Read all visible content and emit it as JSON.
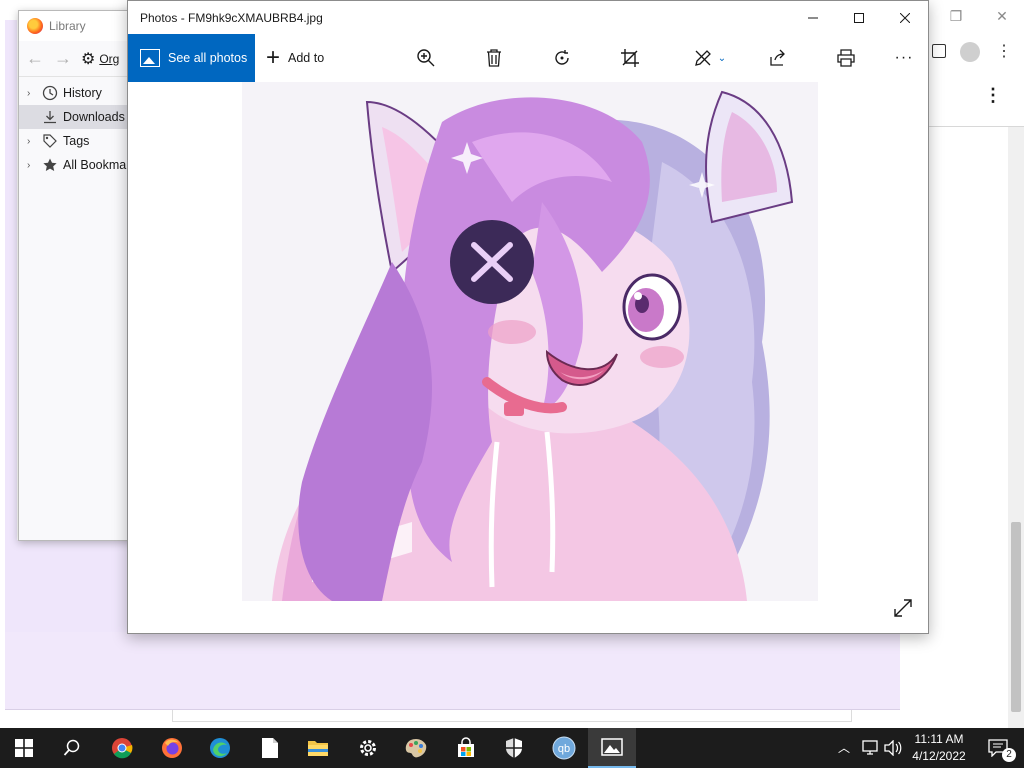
{
  "library": {
    "title": "Library",
    "organize_label": "Org",
    "tree": [
      {
        "label": "History",
        "icon": "clock-icon"
      },
      {
        "label": "Downloads",
        "icon": "download-icon"
      },
      {
        "label": "Tags",
        "icon": "tag-icon"
      },
      {
        "label": "All Bookmar",
        "icon": "star-icon"
      }
    ]
  },
  "photos": {
    "window_title": "Photos - FM9hk9cXMAUBRB4.jpg",
    "see_all_label": "See all photos",
    "add_to_label": "Add to",
    "image_description_icon": "anime-catgirl-artwork"
  },
  "taskbar": {
    "time": "11:11 AM",
    "date": "4/12/2022",
    "notification_count": "2",
    "apps": [
      "windows-start",
      "search",
      "chrome",
      "firefox",
      "edge",
      "file",
      "file-explorer",
      "settings",
      "paint",
      "store",
      "security",
      "qbittorrent",
      "photos"
    ]
  },
  "colors": {
    "accent": "#0067c0",
    "taskbar": "#1c1c1c",
    "purple_bg": "#efe6fb"
  }
}
